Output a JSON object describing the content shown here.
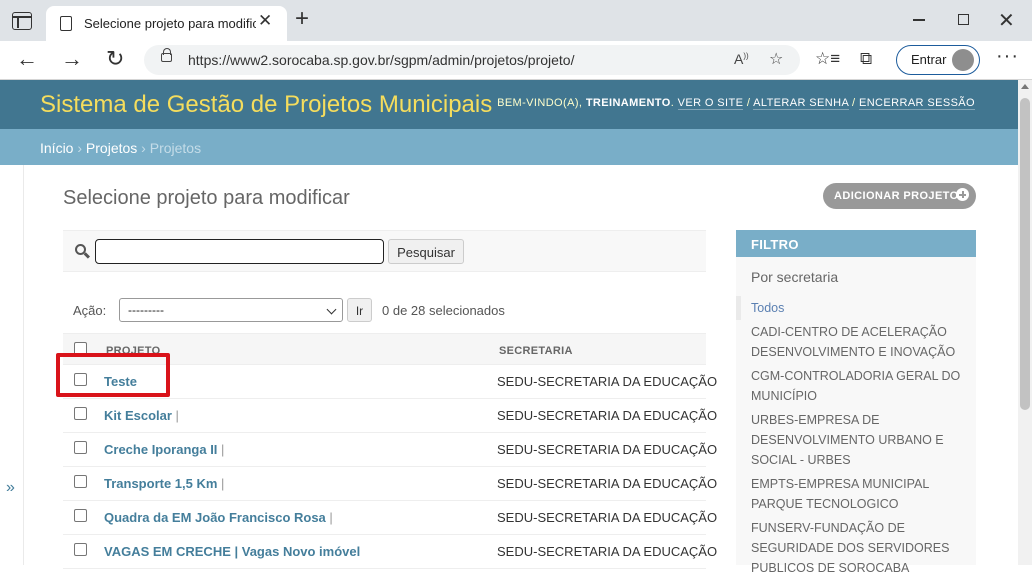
{
  "browser": {
    "tab_title": "Selecione projeto para modificar",
    "url": "https://www2.sorocaba.sp.gov.br/sgpm/admin/projetos/projeto/",
    "signin_label": "Entrar"
  },
  "header": {
    "brand": "Sistema de Gestão de Projetos Municipais",
    "welcome": "Bem-vindo(a),",
    "username": "TREINAMENTO",
    "view_site": "Ver o site",
    "change_password": "Alterar senha",
    "logout": "Encerrar sessão"
  },
  "breadcrumbs": {
    "home": "Início",
    "app": "Projetos",
    "current": "Projetos"
  },
  "content": {
    "title": "Selecione projeto para modificar",
    "add_button": "ADICIONAR PROJETO"
  },
  "search": {
    "value": "",
    "button": "Pesquisar"
  },
  "actions": {
    "label": "Ação:",
    "selected_option": "---------",
    "go_button": "Ir",
    "counter": "0 de 28 selecionados"
  },
  "table": {
    "columns": [
      "PROJETO",
      "SECRETARIA"
    ],
    "rows": [
      {
        "name": "Teste",
        "suffix": "",
        "secretaria": "SEDU-SECRETARIA DA EDUCAÇÃO"
      },
      {
        "name": "Kit Escolar",
        "suffix": " |",
        "secretaria": "SEDU-SECRETARIA DA EDUCAÇÃO"
      },
      {
        "name": "Creche Iporanga II",
        "suffix": " |",
        "secretaria": "SEDU-SECRETARIA DA EDUCAÇÃO"
      },
      {
        "name": "Transporte 1,5 Km",
        "suffix": " |",
        "secretaria": "SEDU-SECRETARIA DA EDUCAÇÃO"
      },
      {
        "name": "Quadra da EM João Francisco Rosa",
        "suffix": " |",
        "secretaria": "SEDU-SECRETARIA DA EDUCAÇÃO"
      },
      {
        "name": "VAGAS EM CRECHE | Vagas Novo imóvel",
        "suffix": "",
        "secretaria": "SEDU-SECRETARIA DA EDUCAÇÃO"
      }
    ]
  },
  "filter": {
    "title": "FILTRO",
    "subtitle": "Por secretaria",
    "items": [
      "Todos",
      "CADI-CENTRO DE ACELERAÇÃO DESENVOLVIMENTO E INOVAÇÃO",
      "CGM-CONTROLADORIA GERAL DO MUNICÍPIO",
      "URBES-EMPRESA DE DESENVOLVIMENTO URBANO E SOCIAL - URBES",
      "EMPTS-EMPRESA MUNICIPAL PARQUE TECNOLOGICO",
      "FUNSERV-FUNDAÇÃO DE SEGURIDADE DOS SERVIDORES PUBLICOS DE SOROCABA"
    ]
  },
  "colors": {
    "header_bg": "#417690",
    "brand_text": "#f5dd5d",
    "breadcrumb_bg": "#79aec8",
    "link": "#447e9b",
    "highlight": "#d9131a"
  }
}
